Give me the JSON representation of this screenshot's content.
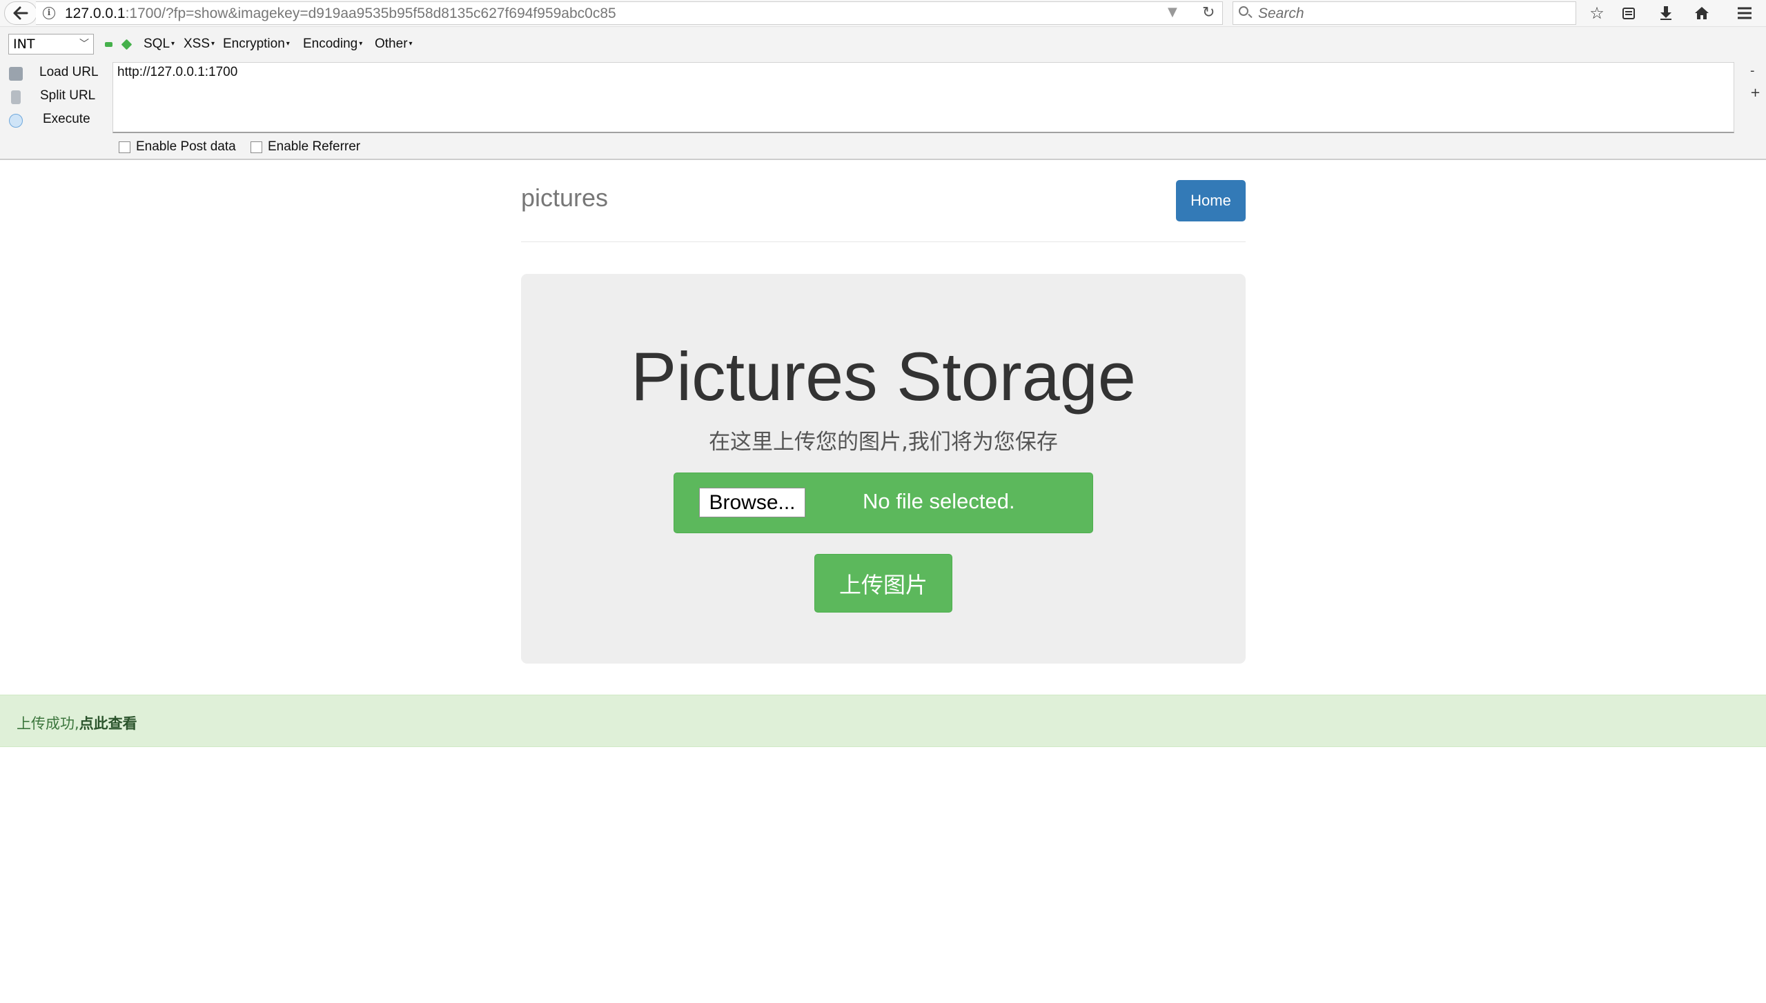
{
  "browser": {
    "url_host": "127.0.0.1",
    "url_rest": ":1700/?fp=show&imagekey=d919aa9535b95f58d8135c627f694f959abc0c85",
    "search_placeholder": "Search"
  },
  "hackbar": {
    "select_value": "INT",
    "menus": [
      "SQL",
      "XSS",
      "Encryption",
      "Encoding",
      "Other"
    ],
    "actions": [
      "Load URL",
      "Split URL",
      "Execute"
    ],
    "url_value": "http://127.0.0.1:1700",
    "side_minus": "-",
    "side_plus": "+",
    "enable_post": "Enable Post data",
    "enable_referrer": "Enable Referrer"
  },
  "page": {
    "brand": "pictures",
    "home_button": "Home",
    "title": "Pictures Storage",
    "subtitle": "在这里上传您的图片,我们将为您保存",
    "browse_button": "Browse...",
    "file_status": "No file selected.",
    "upload_button": "上传图片",
    "alert_text": "上传成功,",
    "alert_link": "点此查看"
  },
  "colors": {
    "primary": "#337ab7",
    "success": "#5cb85c",
    "alert_bg": "#dff0d8",
    "alert_text": "#3c763d"
  }
}
